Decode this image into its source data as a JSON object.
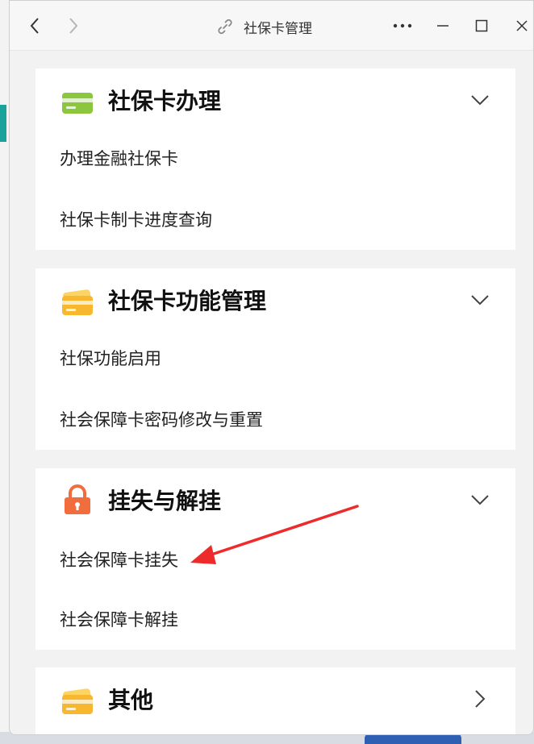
{
  "window": {
    "title": "社保卡管理",
    "controls": [
      "back-icon",
      "forward-icon",
      "more-icon",
      "minimize-icon",
      "maximize-icon",
      "close-icon"
    ]
  },
  "sections": [
    {
      "title": "社保卡办理",
      "icon": "green-card-icon",
      "expanded": true,
      "items": [
        "办理金融社保卡",
        "社保卡制卡进度查询"
      ]
    },
    {
      "title": "社保卡功能管理",
      "icon": "yellow-cards-icon",
      "expanded": true,
      "items": [
        "社保功能启用",
        "社会保障卡密码修改与重置"
      ]
    },
    {
      "title": "挂失与解挂",
      "icon": "orange-lock-icon",
      "expanded": true,
      "items": [
        "社会保障卡挂失",
        "社会保障卡解挂"
      ]
    },
    {
      "title": "其他",
      "icon": "yellow-cards-icon",
      "expanded": false,
      "items": []
    }
  ],
  "annotation": {
    "type": "red-arrow",
    "points_to": "社会保障卡挂失"
  },
  "colors": {
    "green_icon": "#8cc63f",
    "yellow_icon": "#f7b72e",
    "orange_icon": "#f26d3d",
    "arrow": "#ee2b2b"
  }
}
